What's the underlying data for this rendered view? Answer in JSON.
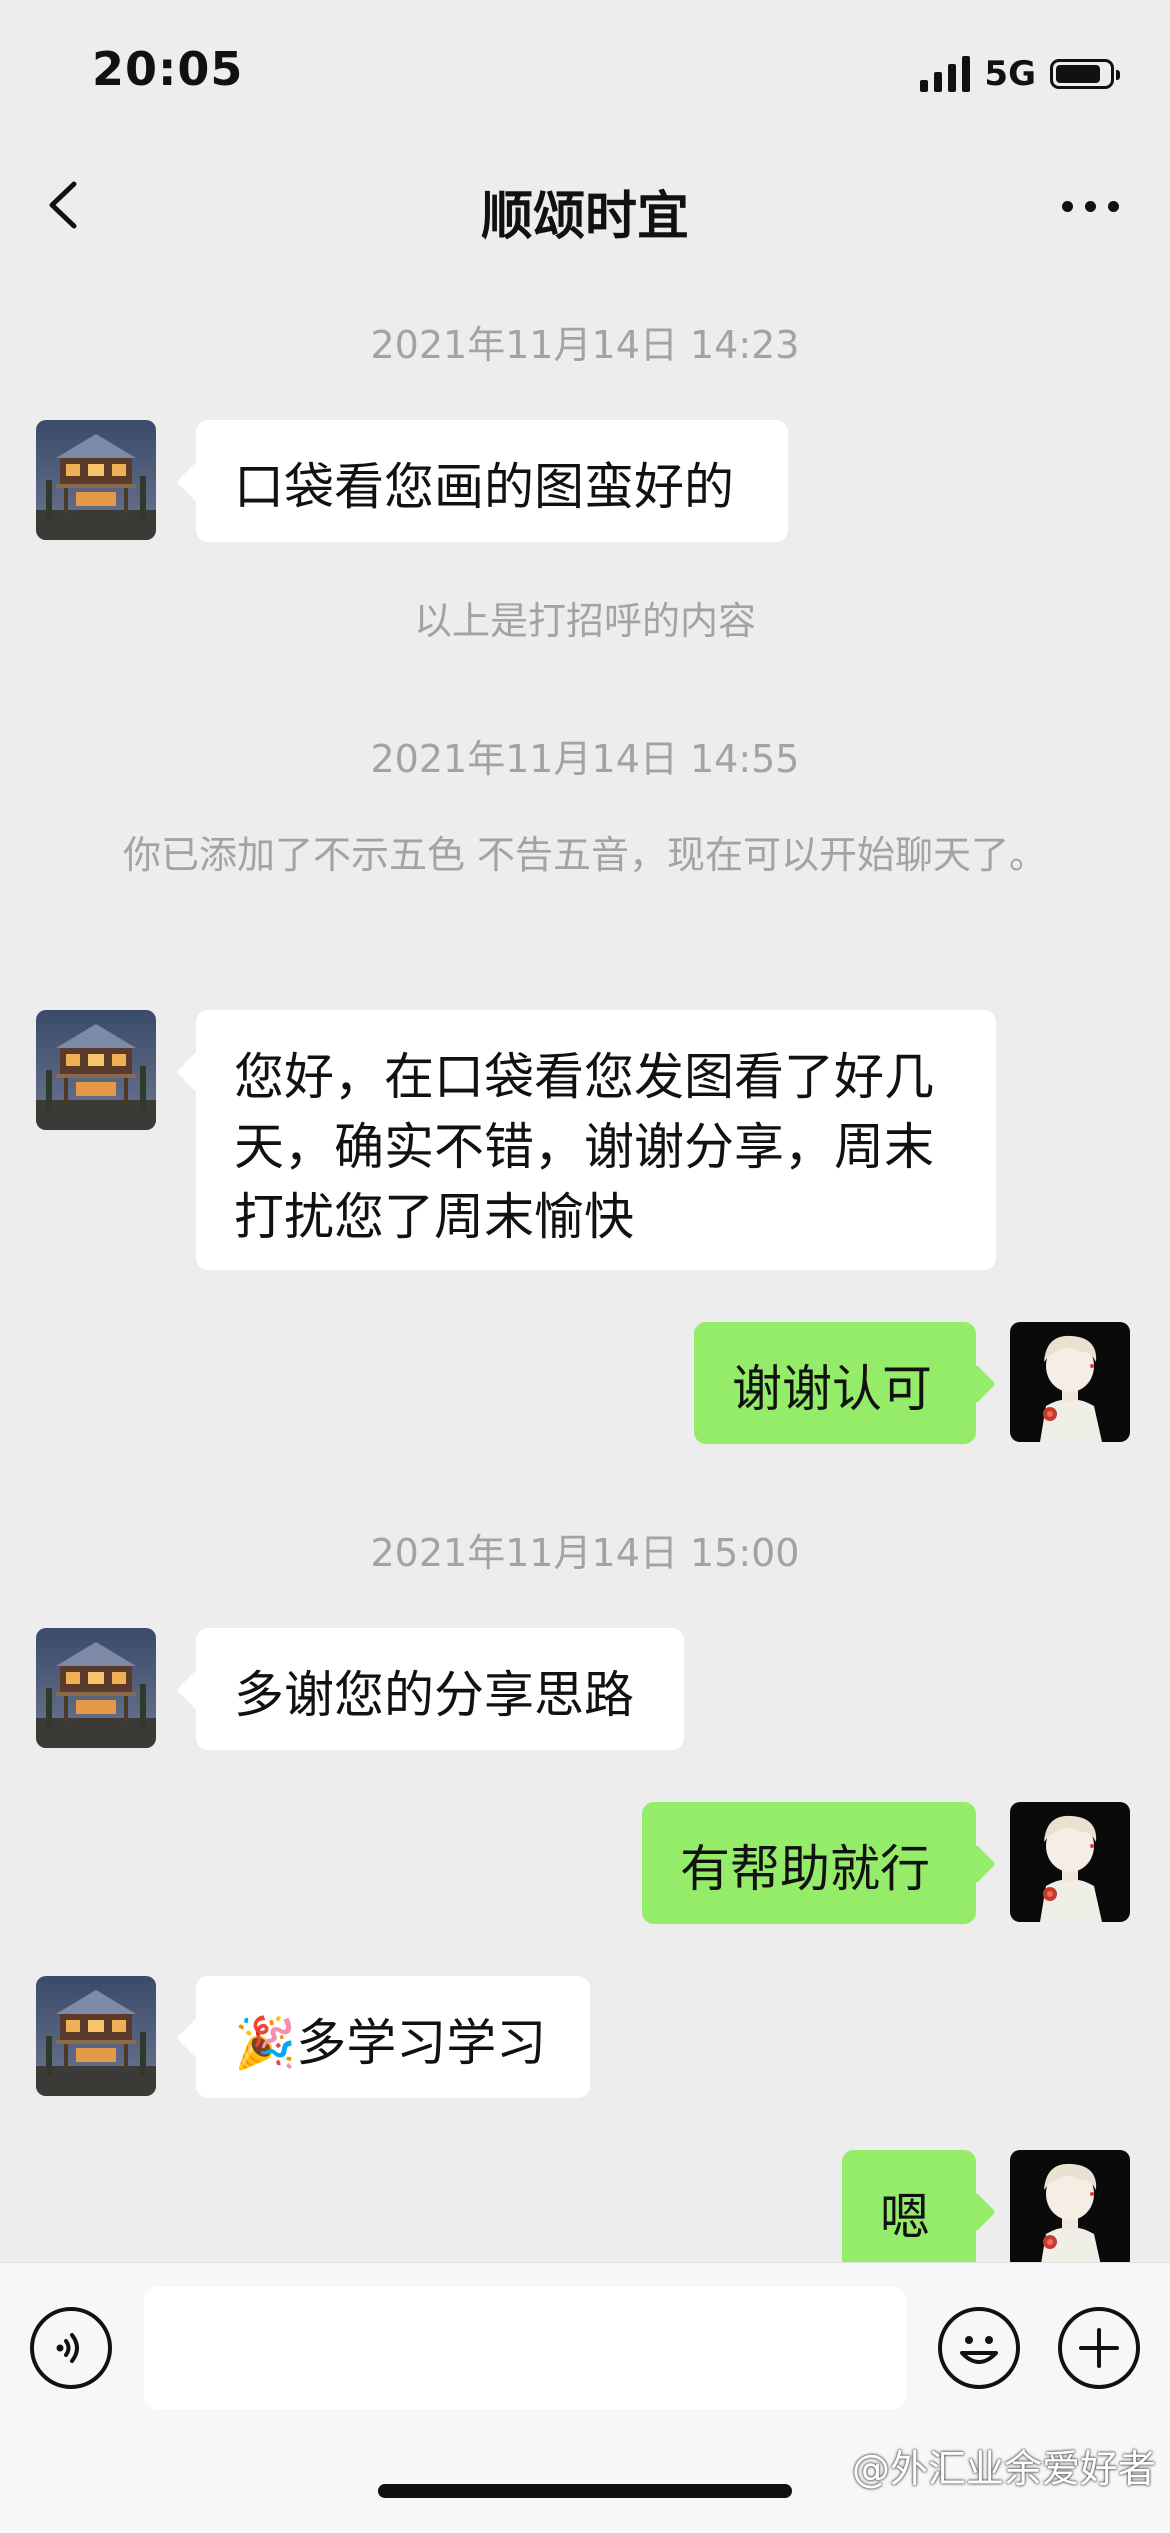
{
  "status_bar": {
    "time": "20:05",
    "network": "5G",
    "battery_level": 0.85
  },
  "nav": {
    "title": "顺颂时宜"
  },
  "messages": {
    "ts1": "2021年11月14日 14:23",
    "m1": "口袋看您画的图蛮好的",
    "sys1": "以上是打招呼的内容",
    "ts2": "2021年11月14日 14:55",
    "sys2": "你已添加了不示五色 不告五音，现在可以开始聊天了。",
    "m2": "您好，在口袋看您发图看了好几天，确实不错，谢谢分享，周末打扰您了周末愉快",
    "m3": "谢谢认可",
    "ts3": "2021年11月14日 15:00",
    "m4": "多谢您的分享思路",
    "m5": "有帮助就行",
    "m6_emoji": "🎉",
    "m6": "多学习学习",
    "m7": "嗯"
  },
  "input_bar": {
    "text_value": ""
  },
  "watermark": "@外汇业余爱好者",
  "colors": {
    "background": "#ededed",
    "outgoing_bubble": "#95ec69",
    "incoming_bubble": "#ffffff",
    "timestamp_text": "#a3a3a3"
  },
  "icons": [
    "back-chevron-icon",
    "more-dots-icon",
    "voice-icon",
    "emoji-icon",
    "plus-icon",
    "signal-icon",
    "battery-icon"
  ]
}
